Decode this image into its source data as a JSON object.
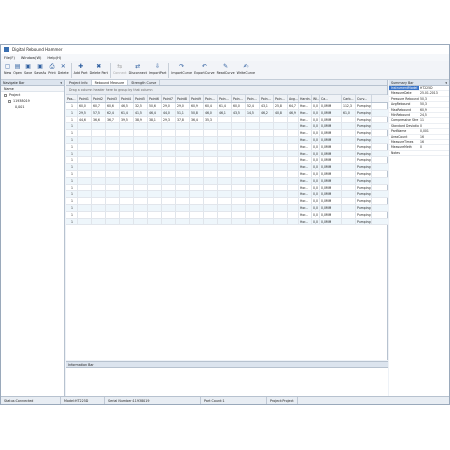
{
  "window": {
    "title": "Digital Rebound Hammer"
  },
  "menu": [
    "File(F)",
    "Window(W)",
    "Help(H)"
  ],
  "toolbar": [
    {
      "label": "New",
      "icon": "new-icon",
      "glyph": "▢"
    },
    {
      "label": "Open",
      "icon": "open-icon",
      "glyph": "▤"
    },
    {
      "label": "Save",
      "icon": "save-icon",
      "glyph": "▣"
    },
    {
      "label": "SaveAs",
      "icon": "save-as-icon",
      "glyph": "▣"
    },
    {
      "label": "Print",
      "icon": "print-icon",
      "glyph": "⎙"
    },
    {
      "label": "Delete",
      "icon": "delete-icon",
      "glyph": "✕"
    },
    {
      "label": "Add Part",
      "icon": "add-part-icon",
      "glyph": "✚"
    },
    {
      "label": "Delete Part",
      "icon": "delete-part-icon",
      "glyph": "✖"
    },
    {
      "label": "Connect",
      "icon": "connect-icon",
      "glyph": "⇆",
      "disabled": true
    },
    {
      "label": "Disconnect",
      "icon": "disconnect-icon",
      "glyph": "⇄"
    },
    {
      "label": "ImportPart",
      "icon": "import-part-icon",
      "glyph": "⇩"
    },
    {
      "label": "ImportCurve",
      "icon": "import-curve-icon",
      "glyph": "↷"
    },
    {
      "label": "ExportCurve",
      "icon": "export-curve-icon",
      "glyph": "↶"
    },
    {
      "label": "ReadCurve",
      "icon": "read-curve-icon",
      "glyph": "✎"
    },
    {
      "label": "WriteCurve",
      "icon": "write-curve-icon",
      "glyph": "✍"
    }
  ],
  "navigate": {
    "title": "Navigate Bar",
    "name_header": "Name",
    "tree": [
      "Project",
      "11938019",
      "0,001"
    ]
  },
  "tabs": [
    "Project Info",
    "Rebound Measure",
    "Strength Curve"
  ],
  "group_hint": "Drag a column header here to group by that column",
  "grid": {
    "columns": [
      "Pos...",
      "Point1",
      "Point2",
      "Point3",
      "Point4",
      "Point5",
      "Point6",
      "Point7",
      "Point8",
      "Point9",
      "Poin...",
      "Poin...",
      "Poin...",
      "Poin...",
      "Poin...",
      "Poin...",
      "Avg...",
      "Hardn...",
      "Wi...",
      "Ca...",
      "Carb...",
      "Curv..."
    ],
    "rows": [
      [
        "1",
        "60,0",
        "60,7",
        "60,6",
        "46,5",
        "32,5",
        "50,6",
        "29,0",
        "29,0",
        "60,9",
        "60,4",
        "61,4",
        "60,0",
        "52,4",
        "43,1",
        "25,8",
        "64,7",
        "Hor...",
        "0,0",
        "0,0MM",
        "112,3",
        "Pumping"
      ],
      [
        "1",
        "29,5",
        "57,5",
        "62,4",
        "61,4",
        "41,5",
        "46,4",
        "44,0",
        "51,1",
        "50,8",
        "46,0",
        "46,1",
        "43,5",
        "14,5",
        "46,2",
        "40,8",
        "46,9",
        "Hor...",
        "0,0",
        "0,0MM",
        "61,0",
        "Pumping"
      ],
      [
        "1",
        "44,6",
        "36,6",
        "36,7",
        "39,5",
        "38,9",
        "38,1",
        "29,3",
        "37,8",
        "36,4",
        "35,3",
        "",
        "",
        "",
        "",
        "",
        "",
        "Hor...",
        "0,0",
        "0,0MM",
        "",
        "Pumping"
      ],
      [
        "1",
        "",
        "",
        "",
        "",
        "",
        "",
        "",
        "",
        "",
        "",
        "",
        "",
        "",
        "",
        "",
        "",
        "Hor...",
        "0,0",
        "0,0MM",
        "",
        "Pumping"
      ],
      [
        "1",
        "",
        "",
        "",
        "",
        "",
        "",
        "",
        "",
        "",
        "",
        "",
        "",
        "",
        "",
        "",
        "",
        "Hor...",
        "0,0",
        "0,0MM",
        "",
        "Pumping"
      ],
      [
        "1",
        "",
        "",
        "",
        "",
        "",
        "",
        "",
        "",
        "",
        "",
        "",
        "",
        "",
        "",
        "",
        "",
        "Hor...",
        "0,0",
        "0,0MM",
        "",
        "Pumping"
      ],
      [
        "1",
        "",
        "",
        "",
        "",
        "",
        "",
        "",
        "",
        "",
        "",
        "",
        "",
        "",
        "",
        "",
        "",
        "Hor...",
        "0,0",
        "0,0MM",
        "",
        "Pumping"
      ],
      [
        "1",
        "",
        "",
        "",
        "",
        "",
        "",
        "",
        "",
        "",
        "",
        "",
        "",
        "",
        "",
        "",
        "",
        "Hor...",
        "0,0",
        "0,0MM",
        "",
        "Pumping"
      ],
      [
        "1",
        "",
        "",
        "",
        "",
        "",
        "",
        "",
        "",
        "",
        "",
        "",
        "",
        "",
        "",
        "",
        "",
        "Hor...",
        "0,0",
        "0,0MM",
        "",
        "Pumping"
      ],
      [
        "1",
        "",
        "",
        "",
        "",
        "",
        "",
        "",
        "",
        "",
        "",
        "",
        "",
        "",
        "",
        "",
        "",
        "Hor...",
        "0,0",
        "0,0MM",
        "",
        "Pumping"
      ],
      [
        "1",
        "",
        "",
        "",
        "",
        "",
        "",
        "",
        "",
        "",
        "",
        "",
        "",
        "",
        "",
        "",
        "",
        "Hor...",
        "0,0",
        "0,0MM",
        "",
        "Pumping"
      ],
      [
        "1",
        "",
        "",
        "",
        "",
        "",
        "",
        "",
        "",
        "",
        "",
        "",
        "",
        "",
        "",
        "",
        "",
        "Hor...",
        "0,0",
        "0,0MM",
        "",
        "Pumping"
      ],
      [
        "1",
        "",
        "",
        "",
        "",
        "",
        "",
        "",
        "",
        "",
        "",
        "",
        "",
        "",
        "",
        "",
        "",
        "Hor...",
        "0,0",
        "0,0MM",
        "",
        "Pumping"
      ],
      [
        "1",
        "",
        "",
        "",
        "",
        "",
        "",
        "",
        "",
        "",
        "",
        "",
        "",
        "",
        "",
        "",
        "",
        "Hor...",
        "0,0",
        "0,0MM",
        "",
        "Pumping"
      ],
      [
        "1",
        "",
        "",
        "",
        "",
        "",
        "",
        "",
        "",
        "",
        "",
        "",
        "",
        "",
        "",
        "",
        "",
        "Hor...",
        "0,0",
        "0,0MM",
        "",
        "Pumping"
      ],
      [
        "1",
        "",
        "",
        "",
        "",
        "",
        "",
        "",
        "",
        "",
        "",
        "",
        "",
        "",
        "",
        "",
        "",
        "Hor...",
        "0,0",
        "0,0MM",
        "",
        "Pumping"
      ],
      [
        "1",
        "",
        "",
        "",
        "",
        "",
        "",
        "",
        "",
        "",
        "",
        "",
        "",
        "",
        "",
        "",
        "",
        "Hor...",
        "0,0",
        "0,0MM",
        "",
        "Pumping"
      ],
      [
        "1",
        "",
        "",
        "",
        "",
        "",
        "",
        "",
        "",
        "",
        "",
        "",
        "",
        "",
        "",
        "",
        "",
        "Hor...",
        "0,0",
        "0,0MM",
        "",
        "Pumping"
      ]
    ]
  },
  "summary": {
    "title": "Summary Bar",
    "props": [
      {
        "k": "InstrumentModel",
        "v": "HT225D",
        "sel": true
      },
      {
        "k": "MeasureDate",
        "v": "25.01.2013"
      },
      {
        "k": "Pressure Rebound",
        "v": "50,3"
      },
      {
        "k": "AvgRebound",
        "v": "50,3"
      },
      {
        "k": "MaxRebound",
        "v": "60,9"
      },
      {
        "k": "MinRebound",
        "v": "24,5"
      },
      {
        "k": "Compressive Stre",
        "v": "11"
      },
      {
        "k": "Standard Deviatio",
        "v": "0"
      },
      {
        "k": "PartName",
        "v": "0,001"
      },
      {
        "k": "AreaCount",
        "v": "16"
      },
      {
        "k": "MeasureTimes",
        "v": "16"
      },
      {
        "k": "MeasureMeth",
        "v": "0"
      },
      {
        "k": "Notes",
        "v": ""
      }
    ]
  },
  "info": {
    "title": "Information Bar"
  },
  "status": [
    "Status:Connected",
    "Model:HT225D",
    "Serial Number:11938019",
    "Part Count:1",
    "Project:Project"
  ],
  "colors": {
    "accent": "#3873c8",
    "alt_row": "#eef6fb"
  }
}
